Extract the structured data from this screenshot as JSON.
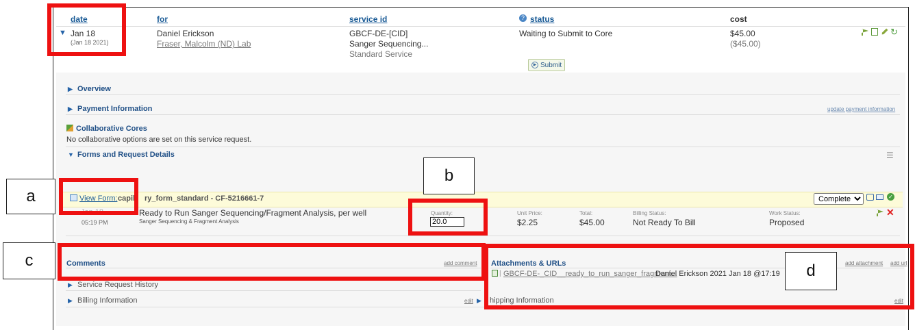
{
  "columns": {
    "date": "date",
    "for": "for",
    "service_id": "service id",
    "status": "status",
    "cost": "cost"
  },
  "request": {
    "date": "Jan 18",
    "date_full": "(Jan 18 2021)",
    "for_name": "Daniel Erickson",
    "for_lab": "Fraser, Malcolm (ND) Lab",
    "service_id": "GBCF-DE-[CID]",
    "service_name": "Sanger Sequencing...",
    "service_type": "Standard Service",
    "status": "Waiting to Submit to Core",
    "submit_label": "Submit",
    "cost": "$45.00",
    "cost_paren": "($45.00)"
  },
  "sections": {
    "overview": "Overview",
    "payment": "Payment Information",
    "update_payment": "update payment information",
    "collab_title": "Collaborative Cores",
    "collab_text": "No collaborative options are set on this service request.",
    "forms": "Forms and Request Details"
  },
  "form": {
    "view_form": "View Form:",
    "form_name_a": "capil",
    "form_name_b": "ry_form_standard - CF-5216661-7",
    "status_select": "Completed",
    "status_options": [
      "Completed"
    ]
  },
  "line_item": {
    "date_partial": "Jan 18",
    "time": "05:19 PM",
    "title": "Ready to Run Sanger Sequencing/Fragment Analysis, per well",
    "subtitle": "Sanger Sequencing & Fragment Analysis",
    "quantity_label": "Quantity:",
    "quantity_value": "20.0",
    "unit_price_label": "Unit Price:",
    "unit_price": "$2.25",
    "total_label": "Total:",
    "total": "$45.00",
    "billing_label": "Billing Status:",
    "billing_status": "Not Ready To Bill",
    "work_label": "Work Status:",
    "work_status": "Proposed"
  },
  "comments": {
    "title": "Comments",
    "add_comment": "add comment"
  },
  "attachments": {
    "title": "Attachments & URLs",
    "add_attachment": "add attachment",
    "add_url": "add url",
    "file_name": "GBCF-DE-_CID__ready_to_run_sanger_fragment...",
    "file_meta": "Daniel Erickson 2021 Jan 18 @17:19"
  },
  "bottom": {
    "history": "Service Request History",
    "billing": "Billing Information",
    "billing_edit": "edit",
    "shipping": "hipping Information",
    "shipping_edit": "edit"
  },
  "callouts": {
    "a": "a",
    "b": "b",
    "c": "c",
    "d": "d"
  },
  "colors": {
    "annotation_red": "#ee1111",
    "link_blue": "#1a5b96",
    "form_row_bg": "#fdfbd9",
    "panel_bg": "#f6f6f6"
  }
}
